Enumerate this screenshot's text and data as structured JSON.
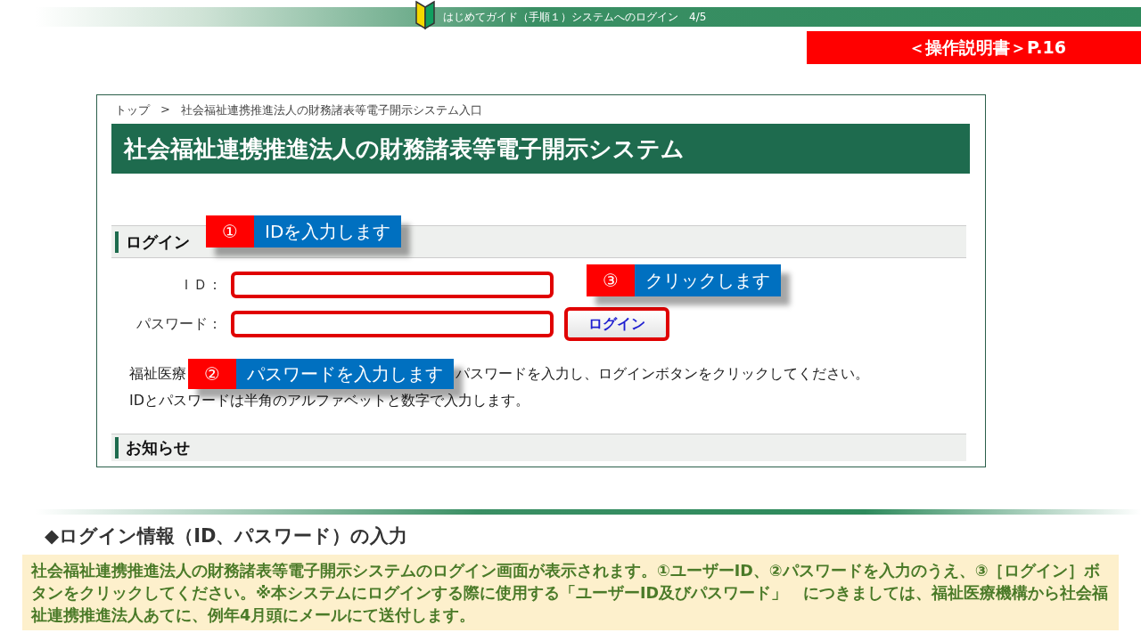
{
  "header": {
    "title": "はじめてガイド（手順１）システムへのログイン　4/5",
    "page_ref": "＜操作説明書＞P.16"
  },
  "screenshot": {
    "breadcrumb": {
      "items": [
        "トップ",
        "社会福祉連携推進法人の財務諸表等電子開示システム入口"
      ],
      "separator": ">"
    },
    "site_title": "社会福祉連携推進法人の財務諸表等電子開示システム",
    "login_heading": "ログイン",
    "fields": [
      {
        "label": "ＩＤ：",
        "highlighted": true
      },
      {
        "label": "パスワード：",
        "highlighted": true
      }
    ],
    "login_button": {
      "label": "ログイン",
      "highlighted": true
    },
    "note_lines": [
      [
        "福祉医療",
        "パスワードを入力し、ログインボタンをクリックしてください。"
      ],
      [
        "IDとパスワードは半角のアルファベットと数字で入力します。"
      ]
    ],
    "news_heading": "お知らせ"
  },
  "callouts": [
    {
      "number": "①",
      "text": "IDを入力します"
    },
    {
      "number": "②",
      "text": "パスワードを入力します"
    },
    {
      "number": "③",
      "text": "クリックします"
    }
  ],
  "summary": {
    "heading": "◆ログイン情報（ID、パスワード）の入力",
    "body": "社会福祉連携推進法人の財務諸表等電子開示システムのログイン画面が表示されます。①ユーザーID、②パスワードを入力のうえ、③［ログイン］ボタンをクリックしてください。※本システムにログインする際に使用する「ユーザーID及びパスワード」　につきましては、福祉医療機構から社会福祉連携推進法人あてに、例年4月頭にメールにて送付します。"
  }
}
